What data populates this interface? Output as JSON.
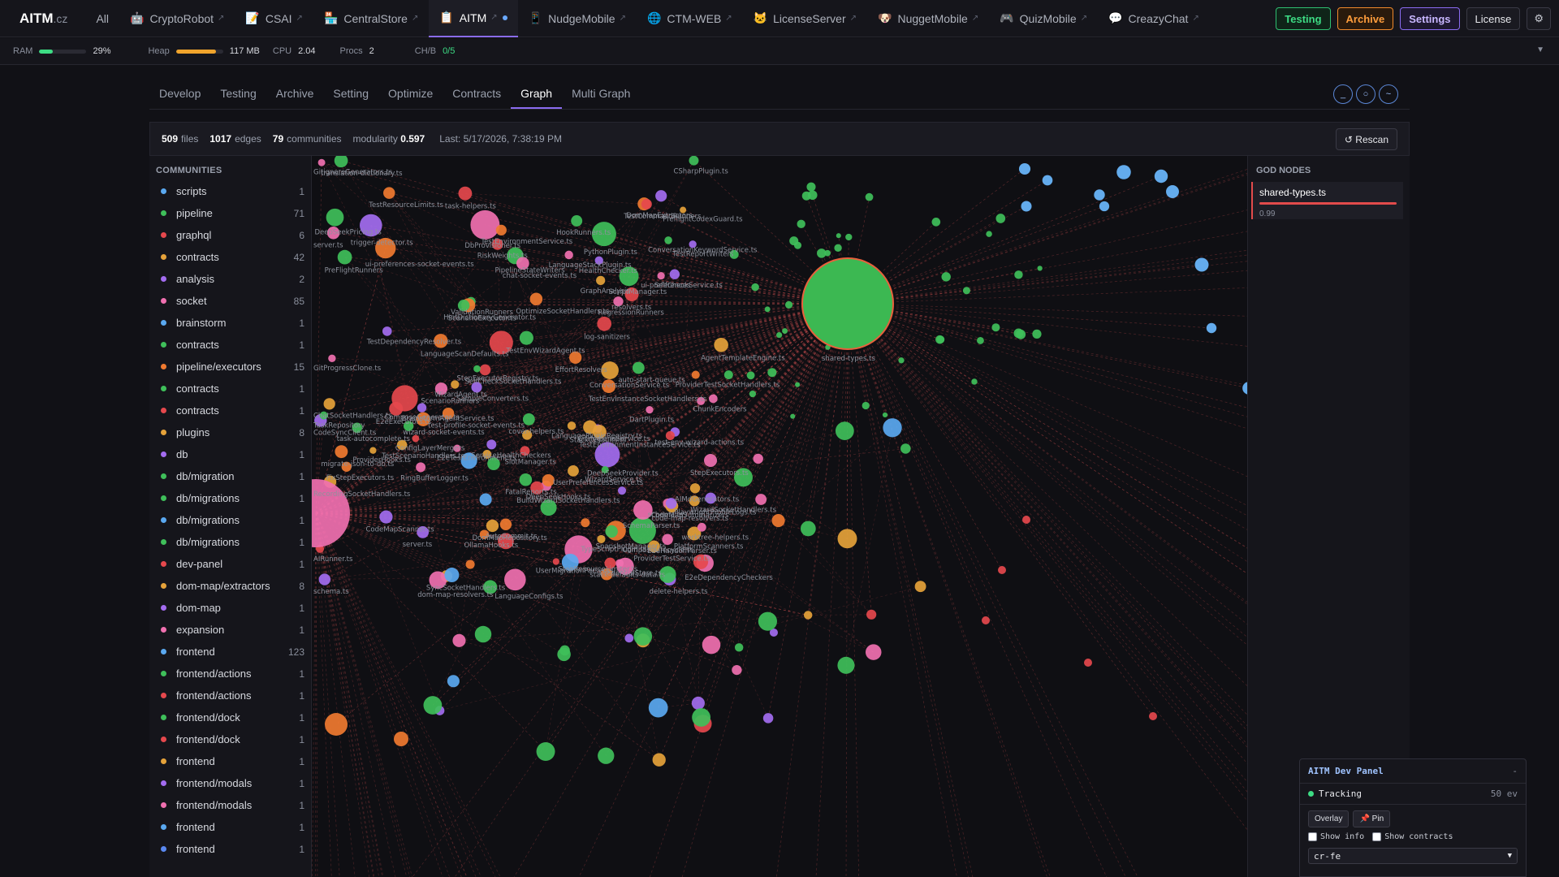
{
  "app": {
    "logo_main": "AITM",
    "logo_tld": ".cz"
  },
  "project_tabs": [
    {
      "label": "All",
      "icon": "",
      "icon_name": "",
      "external": false,
      "active": false
    },
    {
      "label": "CryptoRobot",
      "icon": "🤖",
      "icon_name": "robot-icon",
      "external": true,
      "active": false
    },
    {
      "label": "CSAI",
      "icon": "📝",
      "icon_name": "memo-icon",
      "external": true,
      "active": false
    },
    {
      "label": "CentralStore",
      "icon": "🏪",
      "icon_name": "store-icon",
      "external": true,
      "active": false
    },
    {
      "label": "AITM",
      "icon": "📋",
      "icon_name": "clipboard-icon",
      "external": true,
      "active": true
    },
    {
      "label": "NudgeMobile",
      "icon": "📱",
      "icon_name": "mobile-icon",
      "external": true,
      "active": false
    },
    {
      "label": "CTM-WEB",
      "icon": "🌐",
      "icon_name": "globe-icon",
      "external": true,
      "active": false
    },
    {
      "label": "LicenseServer",
      "icon": "🐱",
      "icon_name": "cat-icon",
      "external": true,
      "active": false
    },
    {
      "label": "NuggetMobile",
      "icon": "🐶",
      "icon_name": "dog-icon",
      "external": true,
      "active": false
    },
    {
      "label": "QuizMobile",
      "icon": "🎮",
      "icon_name": "gamepad-icon",
      "external": true,
      "active": false
    },
    {
      "label": "CreazyChat",
      "icon": "💬",
      "icon_name": "chat-icon",
      "external": true,
      "active": false
    }
  ],
  "top_buttons": {
    "testing": "Testing",
    "archive": "Archive",
    "settings": "Settings",
    "license": "License",
    "gear": "⚙"
  },
  "stats": {
    "ram_label": "RAM",
    "ram_value": "29%",
    "ram_fraction": 0.29,
    "heap_label": "Heap",
    "heap_value": "117 MB",
    "heap_fraction": 0.85,
    "cpu_label": "CPU",
    "cpu_value": "2.04",
    "procs_label": "Procs",
    "procs_value": "2",
    "chb_label": "CH/B",
    "chb_value": "0/5"
  },
  "sub_tabs": [
    "Develop",
    "Testing",
    "Archive",
    "Setting",
    "Optimize",
    "Contracts",
    "Graph",
    "Multi Graph"
  ],
  "active_sub_tab": "Graph",
  "view_controls": [
    "_",
    "○",
    "~"
  ],
  "graph_header": {
    "files": "509",
    "files_label": "files",
    "edges": "1017",
    "edges_label": "edges",
    "communities": "79",
    "communities_label": "communities",
    "modularity_label": "modularity",
    "modularity": "0.597",
    "last": "Last: 5/17/2026, 7:38:19 PM",
    "rescan": "↺ Rescan"
  },
  "communities_title": "COMMUNITIES",
  "communities": [
    {
      "name": "scripts",
      "count": "1",
      "color": "#5aa8f0"
    },
    {
      "name": "pipeline",
      "count": "71",
      "color": "#3fbf5a"
    },
    {
      "name": "graphql",
      "count": "6",
      "color": "#e5484d"
    },
    {
      "name": "contracts",
      "count": "42",
      "color": "#e5a23a"
    },
    {
      "name": "analysis",
      "count": "2",
      "color": "#a36cf0"
    },
    {
      "name": "socket",
      "count": "85",
      "color": "#f070b0"
    },
    {
      "name": "brainstorm",
      "count": "1",
      "color": "#5aa8f0"
    },
    {
      "name": "contracts",
      "count": "1",
      "color": "#3fbf5a"
    },
    {
      "name": "pipeline/executors",
      "count": "15",
      "color": "#f07a30"
    },
    {
      "name": "contracts",
      "count": "1",
      "color": "#3fbf5a"
    },
    {
      "name": "contracts",
      "count": "1",
      "color": "#e5484d"
    },
    {
      "name": "plugins",
      "count": "8",
      "color": "#e5a23a"
    },
    {
      "name": "db",
      "count": "1",
      "color": "#a36cf0"
    },
    {
      "name": "db/migration",
      "count": "1",
      "color": "#3fbf5a"
    },
    {
      "name": "db/migrations",
      "count": "1",
      "color": "#3fbf5a"
    },
    {
      "name": "db/migrations",
      "count": "1",
      "color": "#5aa8f0"
    },
    {
      "name": "db/migrations",
      "count": "1",
      "color": "#3fbf5a"
    },
    {
      "name": "dev-panel",
      "count": "1",
      "color": "#e5484d"
    },
    {
      "name": "dom-map/extractors",
      "count": "8",
      "color": "#e5a23a"
    },
    {
      "name": "dom-map",
      "count": "1",
      "color": "#a36cf0"
    },
    {
      "name": "expansion",
      "count": "1",
      "color": "#f070b0"
    },
    {
      "name": "frontend",
      "count": "123",
      "color": "#5aa8f0"
    },
    {
      "name": "frontend/actions",
      "count": "1",
      "color": "#3fbf5a"
    },
    {
      "name": "frontend/actions",
      "count": "1",
      "color": "#e5484d"
    },
    {
      "name": "frontend/dock",
      "count": "1",
      "color": "#3fbf5a"
    },
    {
      "name": "frontend/dock",
      "count": "1",
      "color": "#e5484d"
    },
    {
      "name": "frontend",
      "count": "1",
      "color": "#e5a23a"
    },
    {
      "name": "frontend/modals",
      "count": "1",
      "color": "#a36cf0"
    },
    {
      "name": "frontend/modals",
      "count": "1",
      "color": "#f070b0"
    },
    {
      "name": "frontend",
      "count": "1",
      "color": "#5aa8f0"
    },
    {
      "name": "frontend",
      "count": "1",
      "color": "#5a88f0"
    }
  ],
  "hub_label": "shared-types.ts",
  "node_labels": [
    "AIRunner.ts",
    "OptimizeSocketHandlers.ts",
    "GitHygieneService.ts",
    "DeepSeekProvider.ts",
    "PlaywrightProfileLogs.ts",
    "TestEnvironmentInstanceService.ts",
    "ValidationRunners",
    "LanguageScanDefaults.ts",
    "SnapshotManager.ts",
    "TestEnvWizardAgent.ts",
    "ScenarioExecutor.ts",
    "TestDependencyResolver.ts",
    "WizardAgent.ts",
    "AutoCommit.ts",
    "SlotManager.ts",
    "BrainstormAgentService.ts",
    "ComposeLifecycle.ts",
    "DbProvisioner.ts",
    "HookRunners.ts",
    "PlatformScanners.ts",
    "ScriptManager.ts",
    "CodeSyncClient.ts",
    "HealthChecker.ts",
    "PreflightCodexGuard.ts",
    "StepResourceLimiter.ts",
    "ChunkEncoders",
    "ComposeGenerator.ts",
    "ConversationService.ts",
    "ProviderHooks.ts",
    "delete-helpers.ts",
    "RingBufferLogger.ts",
    "OllamaHooks.ts",
    "RegressionRunners",
    "SyncSocketHandlers.ts",
    "TestReportWriters",
    "DeepSeekHooks.ts",
    "TestEnvironmentService.ts",
    "FatalReports.ts",
    "ScenarioRunners",
    "ConfigLayerMergers",
    "ProviderTestService.ts",
    "RecordingSocketHandlers.ts",
    "DeepSeekPricing.ts",
    "TaskRepository",
    "TestScenarioHandlers.ts",
    "ServiceHealthCheckers",
    "PreFlightRunners",
    "ProviderTestSocketHandlers.ts",
    "TestResourceLimits.ts",
    "LanguageConfigs.ts",
    "GitignoreGenerators.ts",
    "AIMdGenerators.ts",
    "WizardSocketHandlers.ts",
    "SelfCheckSocketHandlers.ts",
    "StackDefaults.ts",
    "AgentTemplateEngine.ts",
    "task-helpers.ts",
    "CredentialStore.ts",
    "TestCommandRunners",
    "TestEnvInstanceSocketHandlers.ts",
    "SelfCheckService.ts",
    "E2eExecutors.ts",
    "E2eTestEnvironment.ts",
    "CSharpPlugin.ts",
    "TypeScriptPlugin.ts",
    "PythonPlugin.ts",
    "DartPlugin.ts",
    "stack-defaults-data.ts",
    "WizardService.ts",
    "LanguageStackPlugin.ts",
    "LanguagePluginRegistry.ts",
    "migrate-json-to-db.ts",
    "DomMapExtractors",
    "DomMapRepository.ts",
    "ConversationKeywordService.ts",
    "E2eDependencyCheckers",
    "worktree-helpers.ts",
    "GitProgressClone.ts",
    "PipelineStateWriters",
    "EffortResolvers",
    "log-sanitizers",
    "StepExecutors.ts",
    "FixStepExecutors.ts",
    "StepExecutorRegistry.ts",
    "HintDictionaryGenerator.ts",
    "translation-dictionary.ts",
    "resolvers.ts",
    "schema.ts",
    "server.ts",
    "schema.ts",
    "server.ts",
    "code-map-resolvers.ts",
    "GraphAnalysis",
    "CodeMapScanner.ts",
    "SchemaParser.ts",
    "ChatSocketHandlers.ts",
    "CodeMapSummarizers",
    "SampleConverters.ts",
    "chat-socket-events.ts",
    "wizard-socket-events.ts",
    "test-profile-socket-events.ts",
    "ui-preferences-socket-events.ts",
    "test-env-wizard-actions.ts",
    "trigger-detector.ts",
    "task-autocomplete.ts",
    "ui-preferences",
    "RiskWeights.ts",
    "auto-start-queue.ts",
    "UserPreferencesService.ts",
    "dom-map-resolvers.ts",
    "E2eHandoffParser.ts",
    "BuildWizardSocketHandlers.ts",
    "UserMigrationParser.ts",
    "cover-helpers.ts"
  ],
  "god_nodes_title": "GOD NODES",
  "god_nodes": [
    {
      "name": "shared-types.ts",
      "score": "0.99"
    }
  ],
  "dev_panel": {
    "title": "AITM Dev Panel",
    "minimize": "-",
    "status": "Tracking",
    "events": "50 ev",
    "overlay": "Overlay",
    "pin": "📌 Pin",
    "show_info": "Show info",
    "show_contracts": "Show contracts",
    "select_value": "cr-fe"
  }
}
